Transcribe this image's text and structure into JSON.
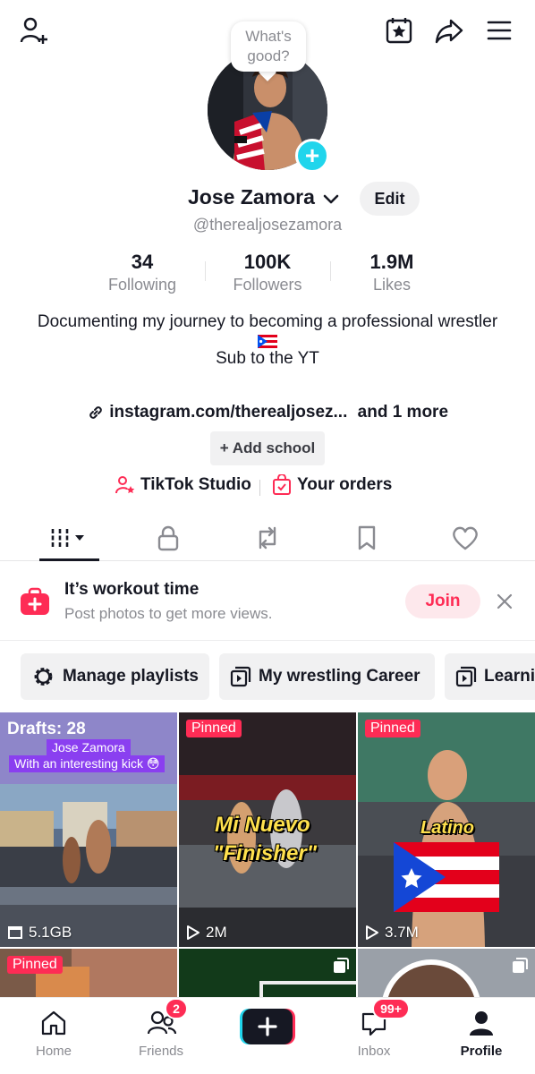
{
  "header": {
    "add_friend_icon": "person-plus-icon",
    "calendar_icon": "calendar-star-icon",
    "share_icon": "share-arrow-icon",
    "menu_icon": "hamburger-menu-icon"
  },
  "profile": {
    "bubble_text": "What's good?",
    "name": "Jose Zamora",
    "edit_label": "Edit",
    "handle": "@therealjosezamora",
    "stats": [
      {
        "value": "34",
        "label": "Following"
      },
      {
        "value": "100K",
        "label": "Followers"
      },
      {
        "value": "1.9M",
        "label": "Likes"
      }
    ],
    "bio_line1": "Documenting my journey to becoming a professional wrestler",
    "bio_line2": "Sub to the YT",
    "link_text": "instagram.com/therealjosez...",
    "link_more": "and 1 more",
    "add_school": "+ Add school",
    "tiktok_studio": "TikTok Studio",
    "your_orders": "Your orders"
  },
  "tabs": [
    "videos-grid",
    "private-lock",
    "reposts",
    "favorites",
    "liked"
  ],
  "promo": {
    "title": "It’s workout time",
    "subtitle": "Post photos to get more views.",
    "join": "Join"
  },
  "playlists": [
    "Manage playlists",
    "My wrestling Career",
    "Learni"
  ],
  "grid": {
    "drafts": {
      "title": "Drafts: 28",
      "tag1": "Jose Zamora",
      "tag2": "With an interesting kick 😳",
      "size": "5.1GB"
    },
    "pinned1": {
      "badge": "Pinned",
      "caption1": "Mi Nuevo",
      "caption2": "\"Finisher\"",
      "views": "2M"
    },
    "pinned2": {
      "badge": "Pinned",
      "caption": "Latino",
      "views": "3.7M"
    },
    "row2_badge": "Pinned"
  },
  "colors": {
    "accent": "#fe2c55",
    "teal": "#20d5ec",
    "muted": "#8a8b91"
  },
  "nav": {
    "home": "Home",
    "friends": "Friends",
    "friends_badge": "2",
    "inbox": "Inbox",
    "inbox_badge": "99+",
    "profile": "Profile"
  }
}
